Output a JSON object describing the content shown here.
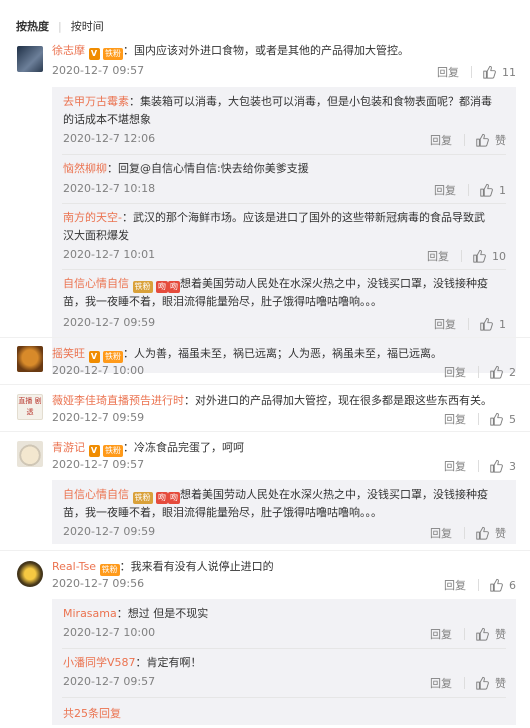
{
  "sort": {
    "hot": "按热度",
    "time": "按时间"
  },
  "comments": [
    {
      "name": "徐志摩",
      "text": "：国内应该对外进口食物，或者是其他的产品得加大管控。",
      "time": "2020-12-7 09:57",
      "reply": "回复",
      "likes": "11",
      "subs": [
        {
          "name": "去甲万古霉素",
          "text": "：集装箱可以消毒，大包装也可以消毒，但是小包装和食物表面呢？都消毒的话成本不堪想象",
          "time": "2020-12-7 12:06",
          "reply": "回复",
          "likes": "赞"
        },
        {
          "name": "恼然柳柳",
          "text": "：回复@自信心情自信:快去给你美爹支援",
          "time": "2020-12-7 10:18",
          "reply": "回复",
          "likes": "1"
        },
        {
          "name": "南方的天空-",
          "text": "：武汉的那个海鲜市场。应该是进口了国外的这些带新冠病毒的食品导致武汉大面积爆发",
          "time": "2020-12-7 10:01",
          "reply": "回复",
          "likes": "10"
        },
        {
          "name": "自信心情自信",
          "text": "想着美国劳动人民处在水深火热之中，没钱买口罩，没钱接种疫苗，我一夜睡不着，眼泪流得能量殆尽，肚子饿得咕噜咕噜响。。。",
          "time": "2020-12-7 09:59",
          "reply": "回复",
          "likes": "1"
        }
      ]
    },
    {
      "name": "摇笑旺",
      "text": "：人为善，福虽未至，祸已远离；人为恶，祸虽未至，福已远离。",
      "time": "2020-12-7 10:00",
      "reply": "回复",
      "likes": "2"
    },
    {
      "name": "薇娅李佳琦直播预告进行时",
      "text": "：对外进口的产品得加大管控，现在很多都是跟这些东西有关。",
      "time": "2020-12-7 09:59",
      "reply": "回复",
      "likes": "5"
    },
    {
      "name": "青游记",
      "text": "：冷冻食品完蛋了，呵呵",
      "time": "2020-12-7 09:57",
      "reply": "回复",
      "likes": "3",
      "subs": [
        {
          "name": "自信心情自信",
          "text": "想着美国劳动人民处在水深火热之中，没钱买口罩，没钱接种疫苗，我一夜睡不着，眼泪流得能量殆尽，肚子饿得咕噜咕噜响。。。",
          "time": "2020-12-7 09:59",
          "reply": "回复",
          "likes": "赞"
        }
      ]
    },
    {
      "name": "Real-Tse",
      "text": "：我来看有没有人说停止进口的",
      "time": "2020-12-7 09:56",
      "reply": "回复",
      "likes": "6",
      "subs": [
        {
          "name": "Mirasama",
          "text": "：想过 但是不现实",
          "time": "2020-12-7 10:00",
          "reply": "回复",
          "likes": "赞"
        },
        {
          "name": "小潘同学V587",
          "text": "：肯定有啊！",
          "time": "2020-12-7 09:57",
          "reply": "回复",
          "likes": "赞"
        }
      ]
    }
  ],
  "more_replies": "共25条回复",
  "badges": {
    "v": "V",
    "fan": "铁粉",
    "sticker": "吻"
  },
  "avatar_text": "直播 剧透",
  "colors": {
    "name": "#eb7350",
    "sub_bg": "#f2f2f5",
    "time": "#808080"
  }
}
